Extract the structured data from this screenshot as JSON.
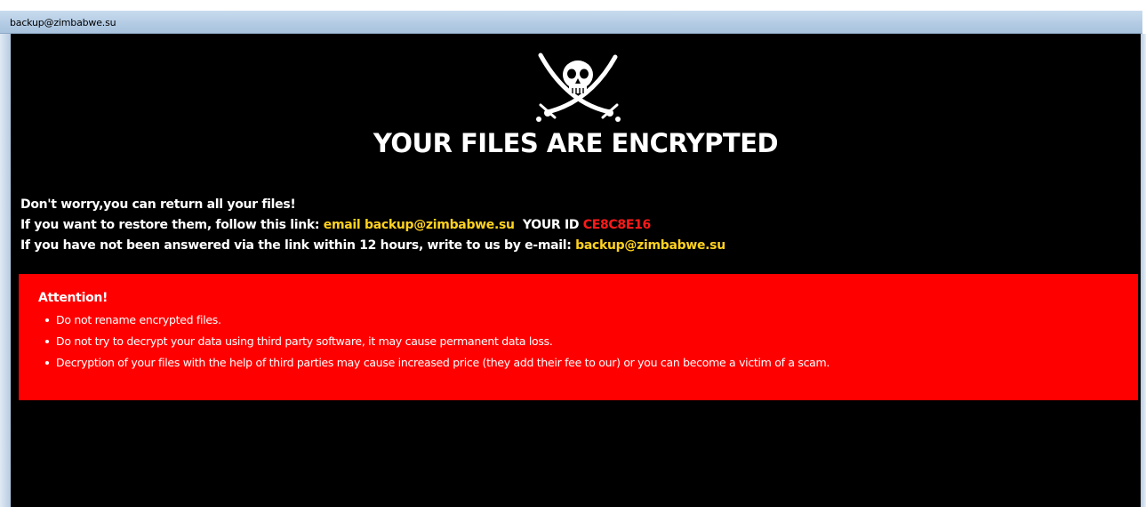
{
  "window": {
    "title": "backup@zimbabwe.su"
  },
  "logo": {
    "icon": "skull-crossed-swords-icon"
  },
  "heading": "YOUR FILES ARE ENCRYPTED",
  "message": {
    "line1": "Don't worry,you can return all your files!",
    "line2_prefix": "If you want to restore them, follow this link: ",
    "line2_link": "email backup@zimbabwe.su",
    "line2_id_label": "YOUR ID",
    "line2_id_value": "CE8C8E16",
    "line3_prefix": "If you have not been answered via the link within 12 hours, write to us by e-mail: ",
    "line3_email": "backup@zimbabwe.su"
  },
  "attention": {
    "title": "Attention!",
    "items": [
      "Do not rename encrypted files.",
      "Do not try to decrypt your data using third party software, it may cause permanent data loss.",
      "Decryption of your files with the help of third parties may cause increased price (they add their fee to our) or you can become a victim of a scam."
    ]
  },
  "colors": {
    "background": "#000000",
    "accent_yellow": "#ffd21f",
    "id_red": "#ff1a1a",
    "attention_box": "#ff0000"
  }
}
